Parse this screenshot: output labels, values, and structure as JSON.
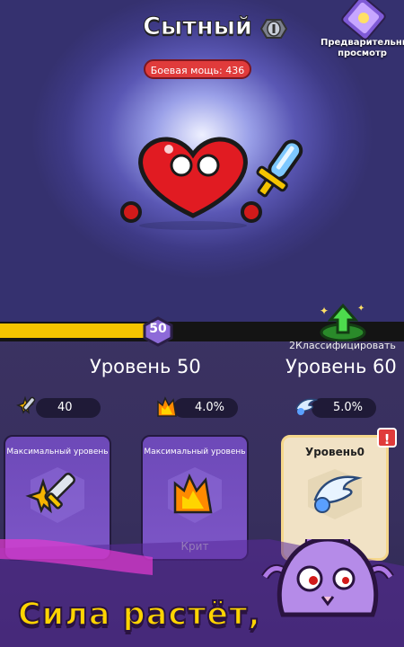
{
  "hero": {
    "name": "Сытный",
    "combat_power": "Боевая мощь: 436"
  },
  "preview": {
    "label": "Предварительный просмотр"
  },
  "level": {
    "badge": "50",
    "current": "Уровень 50",
    "next": "Уровень 60",
    "classify": "2Классифицировать"
  },
  "stats": [
    {
      "icon": "sword-star-icon",
      "value": "40"
    },
    {
      "icon": "crit-burst-icon",
      "value": "4.0%"
    },
    {
      "icon": "wing-speed-icon",
      "value": "5.0%"
    }
  ],
  "cards": [
    {
      "label": "Максимальный уровень",
      "icon": "sword-star-icon"
    },
    {
      "label": "Максимальный уровень",
      "icon": "crit-burst-icon",
      "sublabel": "Крит"
    },
    {
      "label": "Уровень0",
      "icon": "wing-speed-icon",
      "alert": "!"
    }
  ],
  "caption": "Сила растёт,",
  "colors": {
    "power_badge": "#e03b3b",
    "xp_fill": "#f5c400",
    "caption": "#ffd400"
  }
}
